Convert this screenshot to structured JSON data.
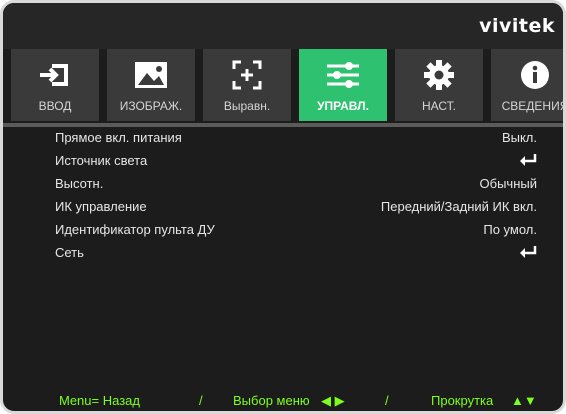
{
  "brand": "vivitek",
  "tabs": [
    {
      "label": "ВВОД",
      "icon": "input-icon"
    },
    {
      "label": "ИЗОБРАЖ.",
      "icon": "image-icon"
    },
    {
      "label": "Выравн.",
      "icon": "align-icon"
    },
    {
      "label": "УПРАВЛ.",
      "icon": "sliders-icon",
      "active": true
    },
    {
      "label": "НАСТ.",
      "icon": "gear-icon"
    },
    {
      "label": "СВЕДЕНИЯ",
      "icon": "info-icon"
    }
  ],
  "menu": [
    {
      "label": "Прямое вкл. питания",
      "value": "Выкл."
    },
    {
      "label": "Источник света",
      "value": ""
    },
    {
      "label": "Высотн.",
      "value": "Обычный"
    },
    {
      "label": "ИК управление",
      "value": "Передний/Задний ИК вкл."
    },
    {
      "label": "Идентификатор пульта ДУ",
      "value": "По умол."
    },
    {
      "label": "Сеть",
      "value": ""
    }
  ],
  "footer": {
    "back": "Menu= Назад",
    "sep1": "/",
    "select": "Выбор меню",
    "select_arrows": "◀ ▶",
    "sep2": "/",
    "scroll": "Прокрутка",
    "scroll_arrows": "▲▼"
  },
  "colors": {
    "active_tab": "#2ec16f",
    "footer_text": "#7cff1e"
  }
}
